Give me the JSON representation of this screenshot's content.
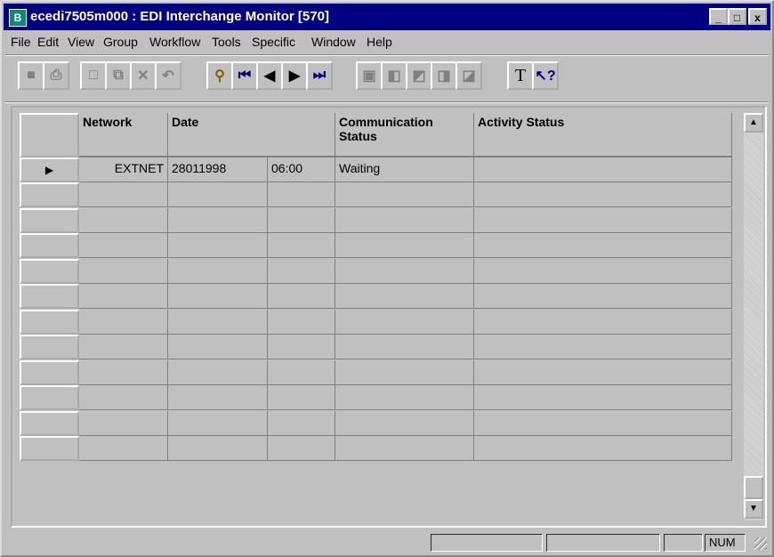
{
  "window": {
    "title": "ecedi7505m000 : EDI Interchange Monitor [570]",
    "icon": "B"
  },
  "title_buttons": [
    "_",
    "□",
    "x"
  ],
  "menu": [
    "File",
    "Edit",
    "View",
    "Group",
    "Workflow",
    "Tools",
    "Specific",
    "Window",
    "Help"
  ],
  "toolbar": {
    "icons": [
      "save-icon",
      "print-icon",
      "new-icon",
      "copy-icon",
      "delete-icon",
      "undo-icon",
      "find-icon",
      "first-record-icon",
      "previous-record-icon",
      "next-record-icon",
      "last-record-icon",
      "form-first-icon",
      "form-previous-icon",
      "form-up-icon",
      "form-next-icon",
      "form-last-icon",
      "text-icon",
      "help-icon"
    ]
  },
  "grid": {
    "columns": [
      "Network",
      "Date",
      "",
      "Communication Status",
      "Activity Status"
    ],
    "rows": [
      {
        "marker": "▶",
        "network": "EXTNET",
        "date": "28011998",
        "time": "06:00",
        "comm_status": "Waiting",
        "activity_status": ""
      }
    ],
    "empty_rows": 11
  },
  "status": {
    "num": "NUM"
  }
}
